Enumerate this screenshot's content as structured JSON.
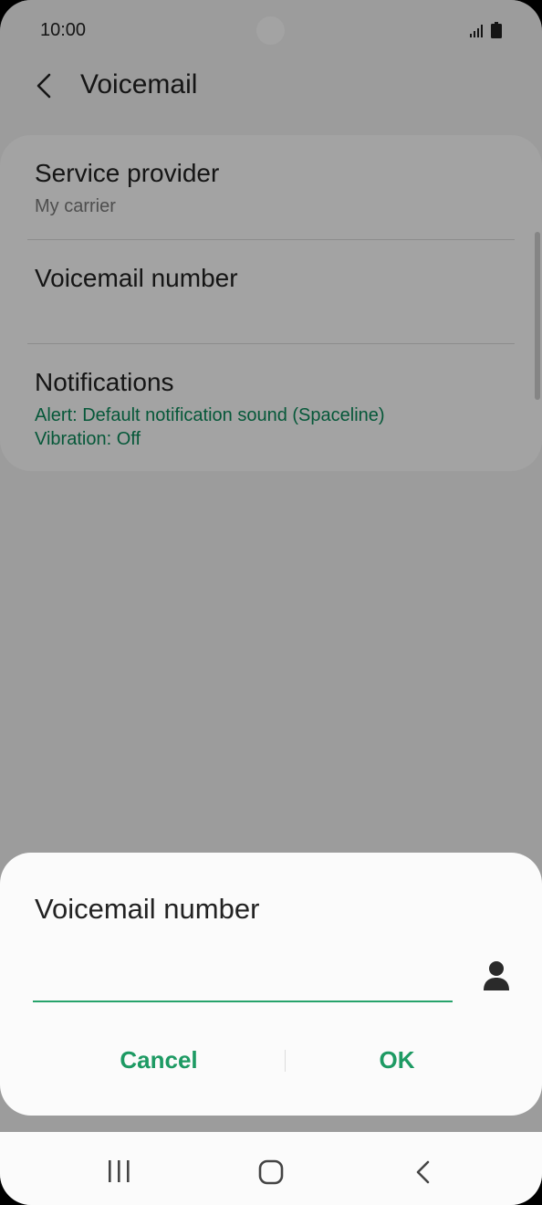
{
  "status_bar": {
    "time": "10:00"
  },
  "app_bar": {
    "title": "Voicemail"
  },
  "settings": [
    {
      "title": "Service provider",
      "subtitle": "My carrier"
    },
    {
      "title": "Voicemail number",
      "subtitle": ""
    },
    {
      "title": "Notifications",
      "lines": [
        "Alert: Default notification sound (Spaceline)",
        "Vibration: Off"
      ]
    }
  ],
  "dialog": {
    "title": "Voicemail number",
    "input_value": "",
    "cancel_label": "Cancel",
    "ok_label": "OK"
  },
  "icons": {
    "back": "chevron-left-icon",
    "contact": "person-icon",
    "nav_recent": "recent-apps-icon",
    "nav_home": "home-icon",
    "nav_back": "back-icon"
  },
  "colors": {
    "accent": "#1d9a63",
    "secondary_text": "#0a8a5a"
  }
}
